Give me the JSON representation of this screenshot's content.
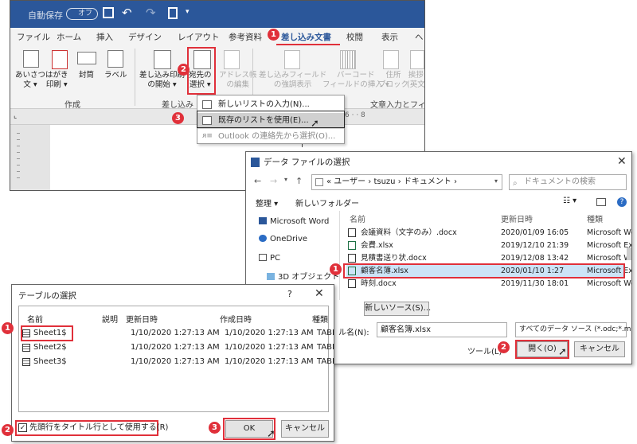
{
  "word": {
    "autosave_label": "自動保存",
    "autosave_state": "オフ",
    "tabs": [
      "ファイル",
      "ホーム",
      "挿入",
      "デザイン",
      "レイアウト",
      "参考資料",
      "差し込み文書",
      "校閲",
      "表示",
      "ヘ"
    ],
    "ribbon": {
      "greeting": "あいさつ\n文 ▾",
      "postcard": "はがき\n印刷 ▾",
      "envelope": "封筒",
      "label": "ラベル",
      "start_merge": "差し込み印刷\nの開始 ▾",
      "select_recipients": "宛先の\n選択 ▾",
      "edit_address_book": "アドレス帳\nの編集",
      "highlight_fields": "差し込みフィールド\nの強調表示",
      "barcode": "バーコード\nフィールドの挿入 ▾",
      "address_block": "住所\nブロック",
      "greeting_line": "挨拶\n(英文",
      "group_create": "作成",
      "group_merge": "差し込み",
      "group_insert": "文章入力とフィー"
    },
    "menu": [
      {
        "label": "新しいリストの入力(N)...",
        "icon": "new-list-icon"
      },
      {
        "label": "既存のリストを使用(E)...",
        "icon": "existing-list-icon"
      },
      {
        "label": "Outlook の連絡先から選択(O)...",
        "icon": "outlook-contacts-icon"
      }
    ]
  },
  "data_dialog": {
    "title": "データ ファイルの選択",
    "path": "« ユーザー › tsuzu › ドキュメント ›",
    "search_placeholder": "ドキュメントの検索",
    "organize": "整理 ▾",
    "new_folder": "新しいフォルダー",
    "nav": [
      "Microsoft Word",
      "OneDrive",
      "PC",
      "3D オブジェクト"
    ],
    "columns": [
      "名前",
      "更新日時",
      "種類"
    ],
    "files": [
      {
        "name": "会議資料（文字のみ）.docx",
        "date": "2020/01/09 16:05",
        "type": "Microsoft Wo"
      },
      {
        "name": "会費.xlsx",
        "date": "2019/12/10 21:39",
        "type": "Microsoft Ex"
      },
      {
        "name": "見積書送り状.docx",
        "date": "2019/12/08 13:42",
        "type": "Microsoft Wo"
      },
      {
        "name": "顧客名簿.xlsx",
        "date": "2020/01/10 1:27",
        "type": "Microsoft Ex"
      },
      {
        "name": "時刻.docx",
        "date": "2019/11/30 18:01",
        "type": "Microsoft Wo"
      }
    ],
    "new_source": "新しいソース(S)...",
    "filename_label": "ル名(N):",
    "filename_value": "顧客名簿.xlsx",
    "filetype_value": "すべてのデータ ソース (*.odc;*.mdb ▾",
    "tools": "ツール(L)",
    "open": "開く(O)",
    "cancel": "キャンセル"
  },
  "table_dialog": {
    "title": "テーブルの選択",
    "help": "?",
    "columns": [
      "名前",
      "説明",
      "更新日時",
      "作成日時",
      "種類"
    ],
    "rows": [
      {
        "name": "Sheet1$",
        "desc": "",
        "modified": "1/10/2020 1:27:13 AM",
        "created": "1/10/2020 1:27:13 AM",
        "type": "TABLE"
      },
      {
        "name": "Sheet2$",
        "desc": "",
        "modified": "1/10/2020 1:27:13 AM",
        "created": "1/10/2020 1:27:13 AM",
        "type": "TABLE"
      },
      {
        "name": "Sheet3$",
        "desc": "",
        "modified": "1/10/2020 1:27:13 AM",
        "created": "1/10/2020 1:27:13 AM",
        "type": "TABLE"
      }
    ],
    "checkbox_label": "先頭行をタイトル行として使用する(R)",
    "ok": "OK",
    "cancel": "キャンセル"
  },
  "callouts": [
    "1",
    "2",
    "3"
  ],
  "colors": {
    "word_blue": "#2b579a",
    "callout_red": "#e0303a",
    "selection": "#cce4f7"
  }
}
